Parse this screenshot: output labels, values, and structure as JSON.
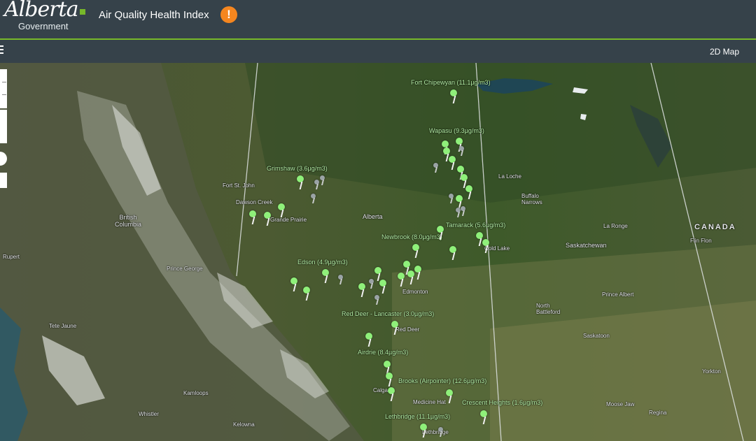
{
  "header": {
    "logo_script": "Alberta",
    "logo_sub": "Government",
    "title": "Air Quality Health Index",
    "alert_symbol": "!"
  },
  "toolbar": {
    "view_toggle": "2D Map"
  },
  "colors": {
    "header_bg": "#36424a",
    "accent": "#77b82a",
    "alert": "#f5861f",
    "station_good": "#8ff07a",
    "station_inactive": "#9aa3a5"
  },
  "map": {
    "place_labels": [
      {
        "text": "CANADA"
      },
      {
        "text": "Alberta"
      },
      {
        "text": "British Columbia"
      },
      {
        "text": "Saskatchewan"
      },
      {
        "text": "Fort St. John"
      },
      {
        "text": "Dawson Creek"
      },
      {
        "text": "Grande Prairie"
      },
      {
        "text": "Prince George"
      },
      {
        "text": "Edmonton"
      },
      {
        "text": "Red Deer"
      },
      {
        "text": "Calgary"
      },
      {
        "text": "Medicine Hat"
      },
      {
        "text": "Lethbridge"
      },
      {
        "text": "La Loche"
      },
      {
        "text": "Buffalo Narrows"
      },
      {
        "text": "Cold Lake"
      },
      {
        "text": "La Ronge"
      },
      {
        "text": "Prince Albert"
      },
      {
        "text": "North Battleford"
      },
      {
        "text": "Saskatoon"
      },
      {
        "text": "Yorkton"
      },
      {
        "text": "Moose Jaw"
      },
      {
        "text": "Regina"
      },
      {
        "text": "Kamloops"
      },
      {
        "text": "Kelowna"
      },
      {
        "text": "Whistler"
      },
      {
        "text": "Flin Flon"
      },
      {
        "text": "Tete Jaune"
      },
      {
        "text": "Rupert"
      }
    ],
    "station_labels": [
      {
        "text": "Fort Chipewyan (11.1µg/m3)"
      },
      {
        "text": "Wapasu (9.3µg/m3)"
      },
      {
        "text": "Grimshaw (3.6µg/m3)"
      },
      {
        "text": "Tamarack (5.6µg/m3)"
      },
      {
        "text": "Newbrook (8.0µg/m3)"
      },
      {
        "text": "Edson (4.9µg/m3)"
      },
      {
        "text": "Red Deer - Lancaster (3.0µg/m3)"
      },
      {
        "text": "Airdrie (8.4µg/m3)"
      },
      {
        "text": "Brooks (Airpointer) (12.6µg/m3)"
      },
      {
        "text": "Crescent Heights (1.6µg/m3)"
      },
      {
        "text": "Lethbridge (11.1µg/m3)"
      }
    ]
  }
}
